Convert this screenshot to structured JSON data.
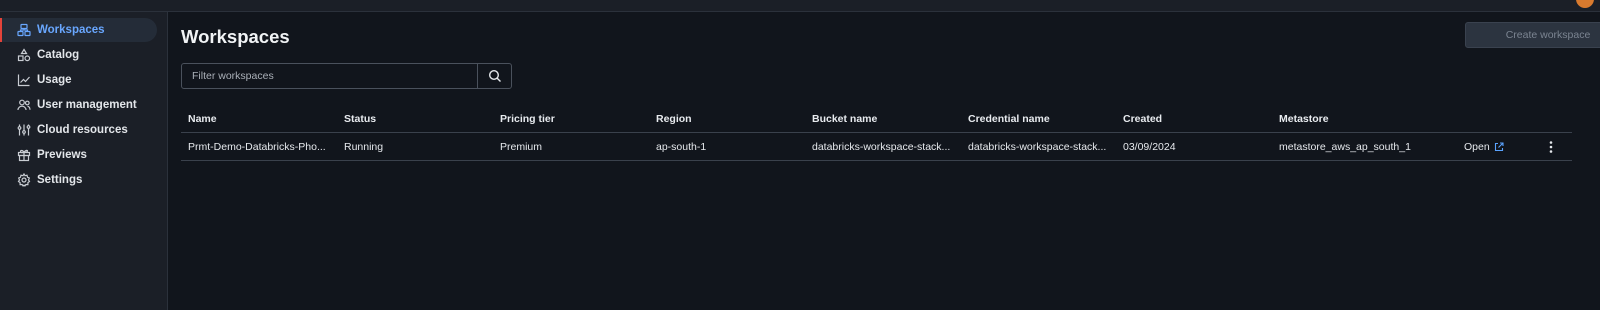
{
  "sidebar": {
    "items": [
      {
        "label": "Workspaces",
        "icon": "workspaces-icon",
        "active": true
      },
      {
        "label": "Catalog",
        "icon": "catalog-icon"
      },
      {
        "label": "Usage",
        "icon": "usage-chart-icon"
      },
      {
        "label": "User management",
        "icon": "users-icon"
      },
      {
        "label": "Cloud resources",
        "icon": "cloud-resources-icon"
      },
      {
        "label": "Previews",
        "icon": "gift-icon"
      },
      {
        "label": "Settings",
        "icon": "gear-icon"
      }
    ]
  },
  "main": {
    "title": "Workspaces",
    "create_button": "Create workspace",
    "search": {
      "placeholder": "Filter workspaces",
      "value": ""
    },
    "table": {
      "columns": [
        "Name",
        "Status",
        "Pricing tier",
        "Region",
        "Bucket name",
        "Credential name",
        "Created",
        "Metastore"
      ],
      "rows": [
        {
          "name": "Prmt-Demo-Databricks-Pho...",
          "status": "Running",
          "pricing_tier": "Premium",
          "region": "ap-south-1",
          "bucket_name": "databricks-workspace-stack...",
          "credential_name": "databricks-workspace-stack...",
          "created": "03/09/2024",
          "metastore": "metastore_aws_ap_south_1",
          "open_label": "Open"
        }
      ]
    }
  },
  "colors": {
    "background": "#11151c",
    "sidebar": "#1b1f27",
    "active_accent": "#e3433a",
    "active_text": "#69a7ff",
    "link": "#5aa3ff"
  }
}
